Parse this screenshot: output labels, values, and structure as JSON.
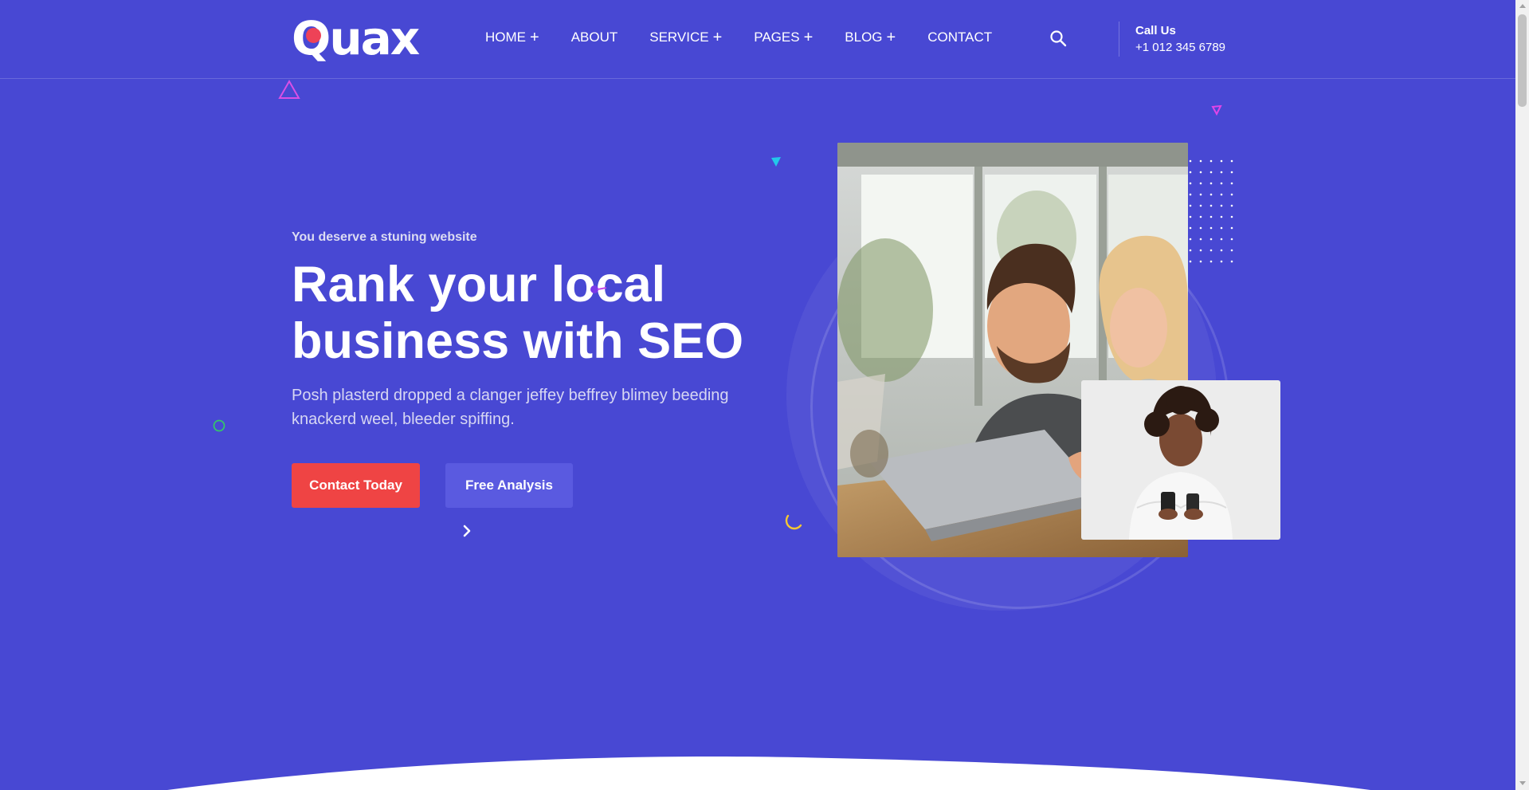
{
  "brand": {
    "name": "uax",
    "logo_letter": "Q"
  },
  "nav": {
    "items": [
      {
        "label": "HOME",
        "has_submenu": true
      },
      {
        "label": "ABOUT",
        "has_submenu": false
      },
      {
        "label": "SERVICE",
        "has_submenu": true
      },
      {
        "label": "PAGES",
        "has_submenu": true
      },
      {
        "label": "BLOG",
        "has_submenu": true
      },
      {
        "label": "CONTACT",
        "has_submenu": false
      }
    ],
    "submenu_marker": "+"
  },
  "header": {
    "call_label": "Call Us",
    "call_number": "+1 012 345 6789",
    "search_icon": "search-icon"
  },
  "hero": {
    "eyebrow": "You deserve a stuning website",
    "title_line1": "Rank your local",
    "title_line2": "business with SEO",
    "description": "Posh plasterd dropped a clanger jeffey beffrey blimey beeding knackerd weel, bleeder spiffing.",
    "primary_button": "Contact Today",
    "secondary_button": "Free Analysis",
    "next_icon": "chevron-right-icon"
  },
  "colors": {
    "background": "#4848d3",
    "primary_button": "#ef4444",
    "secondary_button": "#5a5ae0",
    "logo_dot": "#ee4257"
  }
}
